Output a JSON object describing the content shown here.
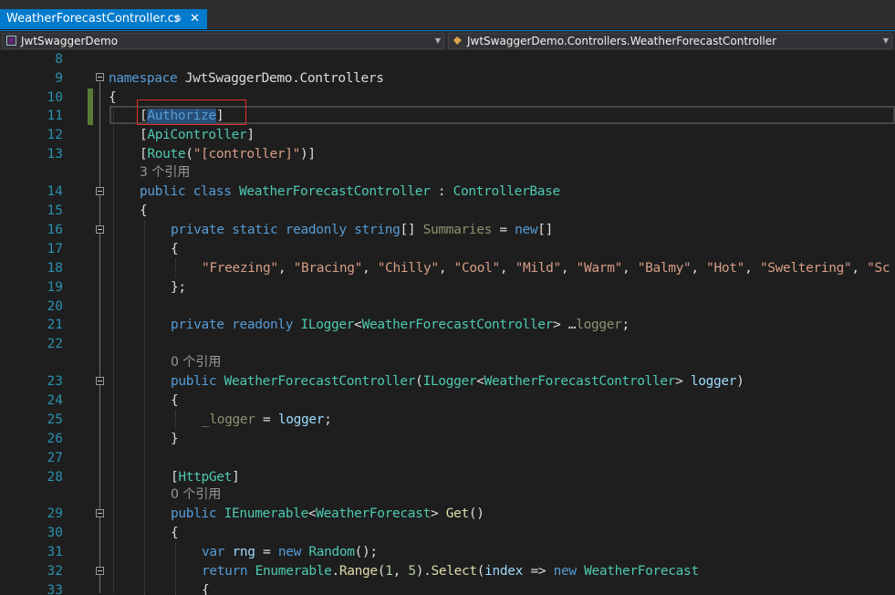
{
  "tab": {
    "title": "WeatherForecastController.cs",
    "pin": "⊅",
    "close": "✕"
  },
  "nav": {
    "project": "JwtSwaggerDemo",
    "type": "JwtSwaggerDemo.Controllers.WeatherForecastController",
    "arrow": "▼"
  },
  "lens": {
    "three_refs": "3 个引用",
    "zero_refs": "0 个引用"
  },
  "lines": [
    {
      "num": "8"
    },
    {
      "num": "9"
    },
    {
      "num": "10"
    },
    {
      "num": "11"
    },
    {
      "num": "12"
    },
    {
      "num": "13"
    },
    {
      "num": "14"
    },
    {
      "num": "15"
    },
    {
      "num": "16"
    },
    {
      "num": "17"
    },
    {
      "num": "18"
    },
    {
      "num": "19"
    },
    {
      "num": "20"
    },
    {
      "num": "21"
    },
    {
      "num": "22"
    },
    {
      "num": "23"
    },
    {
      "num": "24"
    },
    {
      "num": "25"
    },
    {
      "num": "26"
    },
    {
      "num": "27"
    },
    {
      "num": "28"
    },
    {
      "num": "29"
    },
    {
      "num": "30"
    },
    {
      "num": "31"
    },
    {
      "num": "32"
    },
    {
      "num": "33"
    }
  ],
  "code": {
    "l9_kw": "namespace",
    "l9_ns": " JwtSwaggerDemo.Controllers",
    "brace_open": "{",
    "brace_close": "}",
    "brace_close_semi": "};",
    "l11_a": "[",
    "l11_attr": "Authorize",
    "l11_b": "]",
    "l12_a": "[",
    "l12_attr": "ApiController",
    "l12_b": "]",
    "l13_a": "[",
    "l13_attr": "Route",
    "l13_b": "(",
    "l13_str": "\"[controller]\"",
    "l13_c": ")]",
    "l14_kw1": "public",
    "l14_kw2": "class",
    "l14_name": "WeatherForecastController",
    "l14_colon": " : ",
    "l14_base": "ControllerBase",
    "l16_kw1": "private",
    "l16_kw2": "static",
    "l16_kw3": "readonly",
    "l16_kw4": "string",
    "l16_arr": "[] ",
    "l16_field": "Summaries",
    "l16_eq": " = ",
    "l16_new": "new",
    "l16_end": "[]",
    "l18_strings": [
      "\"Freezing\"",
      "\"Bracing\"",
      "\"Chilly\"",
      "\"Cool\"",
      "\"Mild\"",
      "\"Warm\"",
      "\"Balmy\"",
      "\"Hot\"",
      "\"Sweltering\"",
      "\"Sc"
    ],
    "l18_sep": ", ",
    "l21_kw1": "private",
    "l21_kw2": "readonly",
    "l21_type": "ILogger",
    "l21_lt": "<",
    "l21_gen": "WeatherForecastController",
    "l21_gt": ">",
    "l21_dots": " …",
    "l21_field": "logger",
    "l21_semi": ";",
    "l23_kw": "public",
    "l23_name": "WeatherForecastController",
    "l23_open": "(",
    "l23_type": "ILogger",
    "l23_lt": "<",
    "l23_gen": "WeatherForecastController",
    "l23_gt": "> ",
    "l23_param": "logger",
    "l23_close": ")",
    "l25_field": "_logger",
    "l25_eq": " = ",
    "l25_val": "logger",
    "l25_semi": ";",
    "l28_a": "[",
    "l28_attr": "HttpGet",
    "l28_b": "]",
    "l29_kw": "public",
    "l29_type": "IEnumerable",
    "l29_lt": "<",
    "l29_gen": "WeatherForecast",
    "l29_gt": "> ",
    "l29_method": "Get",
    "l29_paren": "()",
    "l31_kw": "var",
    "l31_var": "rng",
    "l31_eq": " = ",
    "l31_new": "new",
    "l31_type": "Random",
    "l31_end": "();",
    "l32_kw": "return",
    "l32_type": "Enumerable",
    "l32_dot": ".",
    "l32_m1": "Range",
    "l32_open": "(",
    "l32_n1": "1",
    "l32_comma": ", ",
    "l32_n2": "5",
    "l32_close": ").",
    "l32_m2": "Select",
    "l32_p": "(",
    "l32_idx": "index",
    "l32_arrow": " => ",
    "l32_new": "new",
    "l32_type2": "WeatherForecast",
    "l33_brace": "{"
  }
}
